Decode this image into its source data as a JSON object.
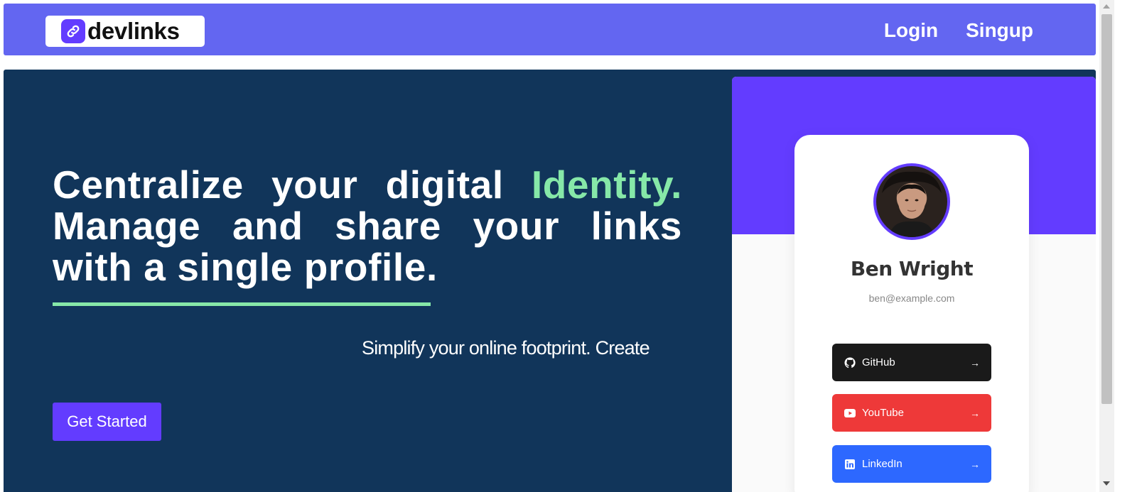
{
  "brand": {
    "name": "devlinks",
    "logo_icon": "link-icon",
    "accent": "#633cff"
  },
  "nav": {
    "login_label": "Login",
    "signup_label": "Singup",
    "bar_color": "#6366f1"
  },
  "hero": {
    "headline_part1": "Centralize your digital ",
    "headline_highlight": "Identity.",
    "headline_part2": " Manage and share your links with a single profile.",
    "marquee_text": "Simplify your online footprint. Create",
    "cta_label": "Get Started",
    "background": "#11355a",
    "highlight_color": "#86e8a8"
  },
  "preview": {
    "name": "Ben Wright",
    "email": "ben@example.com",
    "links": [
      {
        "label": "GitHub",
        "icon": "github-icon",
        "color": "#1a1a1a"
      },
      {
        "label": "YouTube",
        "icon": "youtube-icon",
        "color": "#ee3939"
      },
      {
        "label": "LinkedIn",
        "icon": "linkedin-icon",
        "color": "#2d68ff"
      }
    ]
  }
}
